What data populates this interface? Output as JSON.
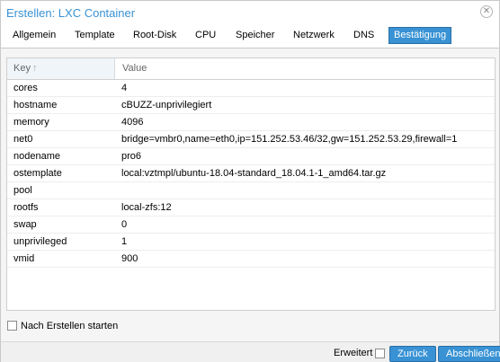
{
  "window": {
    "title": "Erstellen: LXC Container",
    "close_icon": "close-icon"
  },
  "tabs": [
    {
      "label": "Allgemein",
      "active": false
    },
    {
      "label": "Template",
      "active": false
    },
    {
      "label": "Root-Disk",
      "active": false
    },
    {
      "label": "CPU",
      "active": false
    },
    {
      "label": "Speicher",
      "active": false
    },
    {
      "label": "Netzwerk",
      "active": false
    },
    {
      "label": "DNS",
      "active": false
    },
    {
      "label": "Bestätigung",
      "active": true
    }
  ],
  "grid": {
    "columns": {
      "key": "Key",
      "value": "Value"
    },
    "sort_icon": "sort-ascending-icon",
    "rows": [
      {
        "key": "cores",
        "value": "4"
      },
      {
        "key": "hostname",
        "value": "cBUZZ-unprivilegiert"
      },
      {
        "key": "memory",
        "value": "4096"
      },
      {
        "key": "net0",
        "value": "bridge=vmbr0,name=eth0,ip=151.252.53.46/32,gw=151.252.53.29,firewall=1"
      },
      {
        "key": "nodename",
        "value": "pro6"
      },
      {
        "key": "ostemplate",
        "value": "local:vztmpl/ubuntu-18.04-standard_18.04.1-1_amd64.tar.gz"
      },
      {
        "key": "pool",
        "value": ""
      },
      {
        "key": "rootfs",
        "value": "local-zfs:12"
      },
      {
        "key": "swap",
        "value": "0"
      },
      {
        "key": "unprivileged",
        "value": "1"
      },
      {
        "key": "vmid",
        "value": "900"
      }
    ]
  },
  "start_after_create": {
    "label": "Nach Erstellen starten",
    "checked": false
  },
  "footer": {
    "advanced_label": "Erweitert",
    "advanced_checked": false,
    "back_label": "Zurück",
    "finish_label": "Abschließen"
  },
  "colors": {
    "accent": "#3892d4",
    "title": "#3892d4"
  }
}
